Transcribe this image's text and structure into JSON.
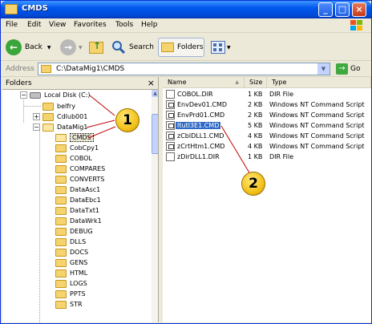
{
  "window": {
    "title": "CMDS"
  },
  "menu": {
    "file": "File",
    "edit": "Edit",
    "view": "View",
    "favorites": "Favorites",
    "tools": "Tools",
    "help": "Help"
  },
  "toolbar": {
    "back": "Back",
    "search": "Search",
    "folders": "Folders"
  },
  "address": {
    "label": "Address",
    "path": "C:\\DataMig1\\CMDS",
    "go": "Go"
  },
  "folders_pane": {
    "title": "Folders",
    "close": "×",
    "root": "Local Disk (C:)",
    "items": [
      "belfry",
      "Cdlub001",
      "DataMig1",
      "CMDS",
      "CobCpy1",
      "COBOL",
      "COMPARES",
      "CONVERTS",
      "DataAsc1",
      "DataEbc1",
      "DataTxt1",
      "DataWrk1",
      "DEBUG",
      "DLLS",
      "DOCS",
      "GENS",
      "HTML",
      "LOGS",
      "PPTS",
      "STR"
    ]
  },
  "files": {
    "headers": {
      "name": "Name",
      "size": "Size",
      "type": "Type"
    },
    "rows": [
      {
        "name": "COBOL.DIR",
        "size": "1 KB",
        "type": "DIR File"
      },
      {
        "name": "EnvDev01.CMD",
        "size": "2 KB",
        "type": "Windows NT Command Script"
      },
      {
        "name": "EnvPrd01.CMD",
        "size": "2 KB",
        "type": "Windows NT Command Script"
      },
      {
        "name": "Itutl3E1.CMD",
        "size": "5 KB",
        "type": "Windows NT Command Script"
      },
      {
        "name": "zCblDLL1.CMD",
        "size": "4 KB",
        "type": "Windows NT Command Script"
      },
      {
        "name": "zCrtHtm1.CMD",
        "size": "4 KB",
        "type": "Windows NT Command Script"
      },
      {
        "name": "zDirDLL1.DIR",
        "size": "1 KB",
        "type": "DIR File"
      }
    ]
  },
  "callouts": {
    "one": "1",
    "two": "2"
  },
  "colors": {
    "title_bar": "#0058ee",
    "selection": "#316ac5",
    "callout": "#f3c21a",
    "callout_line": "#c00000"
  }
}
